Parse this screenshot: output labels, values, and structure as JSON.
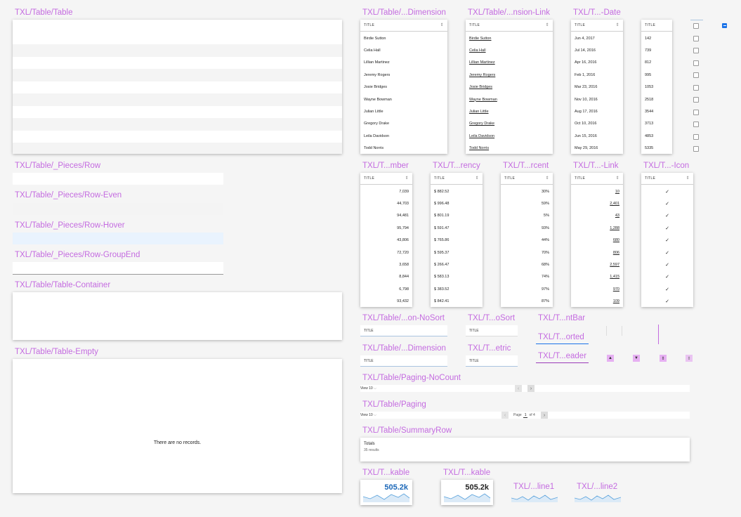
{
  "labels": {
    "table": "TXL/Table/Table",
    "pieces_row": "TXL/Table/_Pieces/Row",
    "pieces_row_even": "TXL/Table/_Pieces/Row-Even",
    "pieces_row_hover": "TXL/Table/_Pieces/Row-Hover",
    "pieces_row_groupend": "TXL/Table/_Pieces/Row-GroupEnd",
    "table_container": "TXL/Table/Table-Container",
    "table_empty": "TXL/Table/Table-Empty",
    "col_dimension": "TXL/Table/...Dimension",
    "col_dimension_link": "TXL/Table/...nsion-Link",
    "col_date": "TXL/T...-Date",
    "col_number": "TXL/T...mber",
    "col_currency": "TXL/T...rency",
    "col_percent": "TXL/T...rcent",
    "col_link": "TXL/T...-Link",
    "col_icon": "TXL/T...-Icon",
    "head_nosort": "TXL/Table/...on-NoSort",
    "head_osort": "TXL/T...oSort",
    "head_dimension": "TXL/Table/...Dimension",
    "head_metric": "TXL/T...etric",
    "ntbar": "TXL/T...ntBar",
    "sorted": "TXL/T...orted",
    "header": "TXL/T...eader",
    "paging_nocount": "TXL/Table/Paging-NoCount",
    "paging": "TXL/Table/Paging",
    "summary_row": "TXL/Table/SummaryRow",
    "kable1": "TXL/T...kable",
    "kable2": "TXL/T...kable",
    "sparkline1": "TXL/...line1",
    "sparkline2": "TXL/...line2"
  },
  "column_header_title": "TITLE",
  "names": [
    "Birdie Sutton",
    "Celia Hall",
    "Lillian Martinez",
    "Jeremy Rogers",
    "Josie Bridges",
    "Wayne Bowman",
    "Julian Little",
    "Gregory Drake",
    "Leila Davidson",
    "Todd Norris"
  ],
  "dates": [
    "Jun 4, 2017",
    "Jul 14, 2016",
    "Apr 16, 2016",
    "Feb 1, 2016",
    "Mar 23, 2016",
    "Nov 10, 2016",
    "Aug 17, 2016",
    "Oct 10, 2016",
    "Jun 15, 2016",
    "May 29, 2016"
  ],
  "small_numbers": [
    "142",
    "739",
    "812",
    "995",
    "1053",
    "2518",
    "3544",
    "3713",
    "4853",
    "5335"
  ],
  "numbers": [
    "7,039",
    "44,703",
    "94,481",
    "95,794",
    "43,806",
    "72,720",
    "3,658",
    "8,844",
    "6,798",
    "93,432"
  ],
  "currency": [
    "$ 882.52",
    "$ 996.48",
    "$ 801.19",
    "$ 591.47",
    "$ 765.86",
    "$ 595.37",
    "$ 266.47",
    "$ 583.13",
    "$ 383.52",
    "$ 842.41"
  ],
  "percent": [
    "30%",
    "59%",
    "5%",
    "93%",
    "44%",
    "70%",
    "68%",
    "74%",
    "97%",
    "87%"
  ],
  "links": [
    "10",
    "2,401",
    "43",
    "1,288",
    "680",
    "806",
    "2,597",
    "1,415",
    "970",
    "109"
  ],
  "empty_message": "There are no records.",
  "paging": {
    "view_label": "View 10",
    "page_label": "Page",
    "page_value": "1",
    "of_label": "of 4"
  },
  "summary": {
    "title": "Totals",
    "results": "35 results"
  },
  "kpi": {
    "value1": "505.2k",
    "value2": "505.2k",
    "accent": "#1b67b8",
    "spark_color": "#5aa2dc"
  },
  "colors": {
    "label": "#c46be0",
    "stripe": "#f4f4f4",
    "hover": "#e9f3fe",
    "selected": "#1a73e8"
  }
}
